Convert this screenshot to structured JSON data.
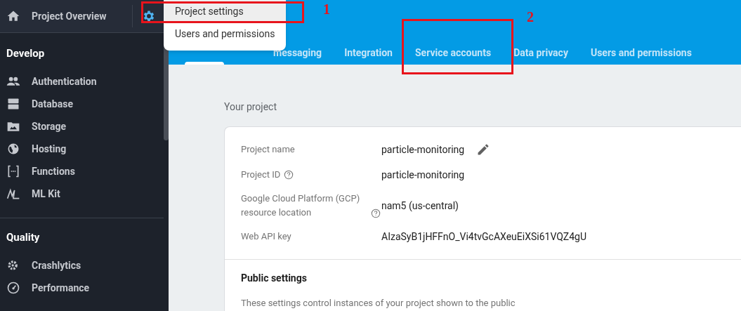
{
  "header": {
    "title": "Project Overview"
  },
  "sidebar": {
    "sections": [
      {
        "title": "Develop",
        "items": [
          {
            "label": "Authentication"
          },
          {
            "label": "Database"
          },
          {
            "label": "Storage"
          },
          {
            "label": "Hosting"
          },
          {
            "label": "Functions"
          },
          {
            "label": "ML Kit"
          }
        ]
      },
      {
        "title": "Quality",
        "items": [
          {
            "label": "Crashlytics"
          },
          {
            "label": "Performance"
          }
        ]
      }
    ]
  },
  "menu": {
    "items": [
      {
        "label": "Project settings",
        "selected": true
      },
      {
        "label": "Users and permissions",
        "selected": false
      }
    ]
  },
  "tabs": [
    {
      "selected": true
    },
    {
      "label": "messaging",
      "selected": false
    },
    {
      "label": "Integration",
      "selected": false
    },
    {
      "label": "Service accounts",
      "selected": false
    },
    {
      "label": "Data privacy",
      "selected": false
    },
    {
      "label": "Users and permissions",
      "selected": false
    }
  ],
  "section_title": "Your project",
  "fields": [
    {
      "label": "Project name",
      "value": "particle-monitoring",
      "help": false,
      "editable": true
    },
    {
      "label": "Project ID",
      "value": "particle-monitoring",
      "help": true,
      "editable": false
    },
    {
      "label": "Google Cloud Platform (GCP) resource location",
      "value": "nam5 (us-central)",
      "help": true,
      "editable": false
    },
    {
      "label": "Web API key",
      "value": "AIzaSyB1jHFFnO_Vi4tvGcAXeuEiXSi61VQZ4gU",
      "help": false,
      "editable": false
    }
  ],
  "public_settings": {
    "title": "Public settings",
    "description": "These settings control instances of your project shown to the public"
  },
  "annotations": [
    {
      "label": "1"
    },
    {
      "label": "2"
    }
  ]
}
